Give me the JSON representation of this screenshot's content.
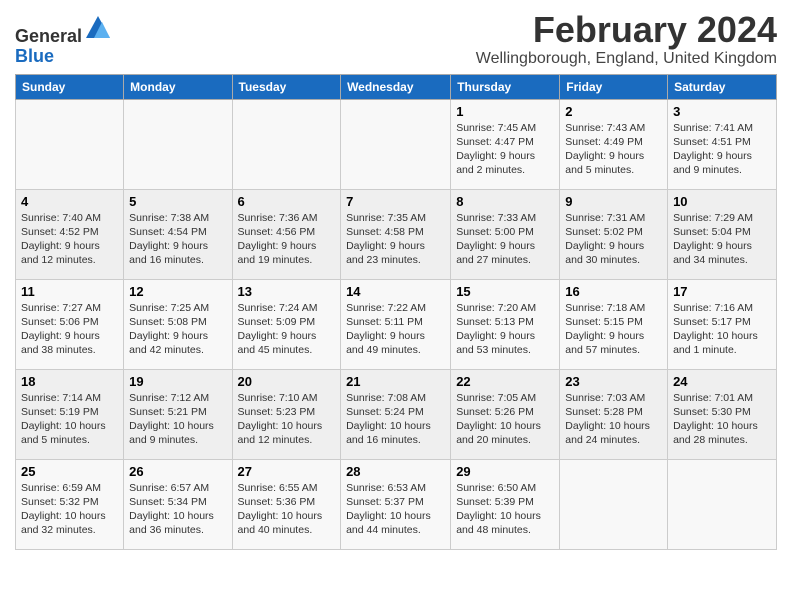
{
  "header": {
    "logo_line1": "General",
    "logo_line2": "Blue",
    "main_title": "February 2024",
    "subtitle": "Wellingborough, England, United Kingdom"
  },
  "days_of_week": [
    "Sunday",
    "Monday",
    "Tuesday",
    "Wednesday",
    "Thursday",
    "Friday",
    "Saturday"
  ],
  "weeks": [
    [
      {
        "day": "",
        "content": ""
      },
      {
        "day": "",
        "content": ""
      },
      {
        "day": "",
        "content": ""
      },
      {
        "day": "",
        "content": ""
      },
      {
        "day": "1",
        "content": "Sunrise: 7:45 AM\nSunset: 4:47 PM\nDaylight: 9 hours and 2 minutes."
      },
      {
        "day": "2",
        "content": "Sunrise: 7:43 AM\nSunset: 4:49 PM\nDaylight: 9 hours and 5 minutes."
      },
      {
        "day": "3",
        "content": "Sunrise: 7:41 AM\nSunset: 4:51 PM\nDaylight: 9 hours and 9 minutes."
      }
    ],
    [
      {
        "day": "4",
        "content": "Sunrise: 7:40 AM\nSunset: 4:52 PM\nDaylight: 9 hours and 12 minutes."
      },
      {
        "day": "5",
        "content": "Sunrise: 7:38 AM\nSunset: 4:54 PM\nDaylight: 9 hours and 16 minutes."
      },
      {
        "day": "6",
        "content": "Sunrise: 7:36 AM\nSunset: 4:56 PM\nDaylight: 9 hours and 19 minutes."
      },
      {
        "day": "7",
        "content": "Sunrise: 7:35 AM\nSunset: 4:58 PM\nDaylight: 9 hours and 23 minutes."
      },
      {
        "day": "8",
        "content": "Sunrise: 7:33 AM\nSunset: 5:00 PM\nDaylight: 9 hours and 27 minutes."
      },
      {
        "day": "9",
        "content": "Sunrise: 7:31 AM\nSunset: 5:02 PM\nDaylight: 9 hours and 30 minutes."
      },
      {
        "day": "10",
        "content": "Sunrise: 7:29 AM\nSunset: 5:04 PM\nDaylight: 9 hours and 34 minutes."
      }
    ],
    [
      {
        "day": "11",
        "content": "Sunrise: 7:27 AM\nSunset: 5:06 PM\nDaylight: 9 hours and 38 minutes."
      },
      {
        "day": "12",
        "content": "Sunrise: 7:25 AM\nSunset: 5:08 PM\nDaylight: 9 hours and 42 minutes."
      },
      {
        "day": "13",
        "content": "Sunrise: 7:24 AM\nSunset: 5:09 PM\nDaylight: 9 hours and 45 minutes."
      },
      {
        "day": "14",
        "content": "Sunrise: 7:22 AM\nSunset: 5:11 PM\nDaylight: 9 hours and 49 minutes."
      },
      {
        "day": "15",
        "content": "Sunrise: 7:20 AM\nSunset: 5:13 PM\nDaylight: 9 hours and 53 minutes."
      },
      {
        "day": "16",
        "content": "Sunrise: 7:18 AM\nSunset: 5:15 PM\nDaylight: 9 hours and 57 minutes."
      },
      {
        "day": "17",
        "content": "Sunrise: 7:16 AM\nSunset: 5:17 PM\nDaylight: 10 hours and 1 minute."
      }
    ],
    [
      {
        "day": "18",
        "content": "Sunrise: 7:14 AM\nSunset: 5:19 PM\nDaylight: 10 hours and 5 minutes."
      },
      {
        "day": "19",
        "content": "Sunrise: 7:12 AM\nSunset: 5:21 PM\nDaylight: 10 hours and 9 minutes."
      },
      {
        "day": "20",
        "content": "Sunrise: 7:10 AM\nSunset: 5:23 PM\nDaylight: 10 hours and 12 minutes."
      },
      {
        "day": "21",
        "content": "Sunrise: 7:08 AM\nSunset: 5:24 PM\nDaylight: 10 hours and 16 minutes."
      },
      {
        "day": "22",
        "content": "Sunrise: 7:05 AM\nSunset: 5:26 PM\nDaylight: 10 hours and 20 minutes."
      },
      {
        "day": "23",
        "content": "Sunrise: 7:03 AM\nSunset: 5:28 PM\nDaylight: 10 hours and 24 minutes."
      },
      {
        "day": "24",
        "content": "Sunrise: 7:01 AM\nSunset: 5:30 PM\nDaylight: 10 hours and 28 minutes."
      }
    ],
    [
      {
        "day": "25",
        "content": "Sunrise: 6:59 AM\nSunset: 5:32 PM\nDaylight: 10 hours and 32 minutes."
      },
      {
        "day": "26",
        "content": "Sunrise: 6:57 AM\nSunset: 5:34 PM\nDaylight: 10 hours and 36 minutes."
      },
      {
        "day": "27",
        "content": "Sunrise: 6:55 AM\nSunset: 5:36 PM\nDaylight: 10 hours and 40 minutes."
      },
      {
        "day": "28",
        "content": "Sunrise: 6:53 AM\nSunset: 5:37 PM\nDaylight: 10 hours and 44 minutes."
      },
      {
        "day": "29",
        "content": "Sunrise: 6:50 AM\nSunset: 5:39 PM\nDaylight: 10 hours and 48 minutes."
      },
      {
        "day": "",
        "content": ""
      },
      {
        "day": "",
        "content": ""
      }
    ]
  ]
}
